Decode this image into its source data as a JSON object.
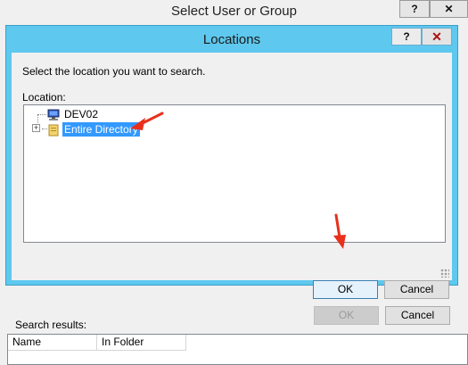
{
  "outer_window": {
    "title": "Select User or Group",
    "help_label": "?",
    "close_label": "✕",
    "ok_label": "OK",
    "cancel_label": "Cancel",
    "search_results_label": "Search results:",
    "columns": [
      "Name",
      "In Folder"
    ]
  },
  "locations_dialog": {
    "title": "Locations",
    "help_label": "?",
    "close_label": "✕",
    "instruction": "Select the location you want to search.",
    "location_label": "Location:",
    "tree": [
      {
        "label": "DEV02",
        "icon": "computer-icon",
        "selected": false
      },
      {
        "label": "Entire Directory",
        "icon": "directory-icon",
        "selected": true,
        "expander": "+"
      }
    ],
    "ok_label": "OK",
    "cancel_label": "Cancel"
  },
  "annotation_color": "#e8301c"
}
